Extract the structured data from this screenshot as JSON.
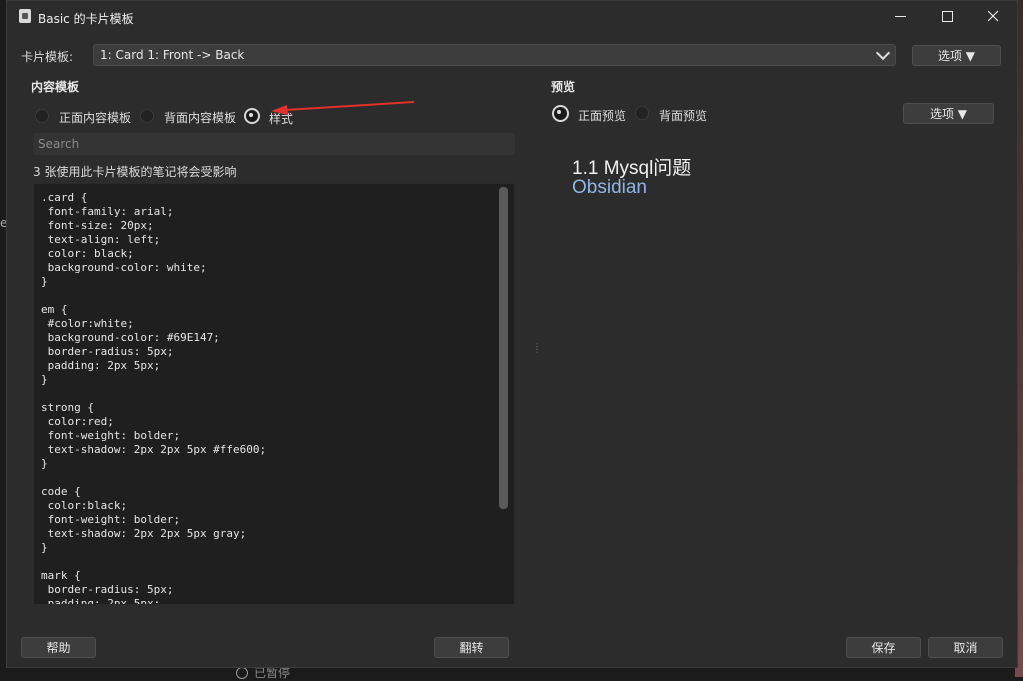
{
  "window": {
    "title": "Basic 的卡片模板"
  },
  "header": {
    "template_label": "卡片模板:",
    "template_value": "1: Card 1: Front -> Back",
    "options_button": "选项 ▼"
  },
  "content": {
    "section_title": "内容模板",
    "radios": [
      {
        "label": "正面内容模板",
        "checked": false
      },
      {
        "label": "背面内容模板",
        "checked": false
      },
      {
        "label": "样式",
        "checked": true
      }
    ],
    "search_placeholder": "Search",
    "affects_text": "3 张使用此卡片模板的笔记将会受影响",
    "editor_text": ".card {\n font-family: arial;\n font-size: 20px;\n text-align: left;\n color: black;\n background-color: white;\n}\n\nem {\n #color:white;\n background-color: #69E147;\n border-radius: 5px;\n padding: 2px 5px;\n}\n\nstrong {\n color:red;\n font-weight: bolder;\n text-shadow: 2px 2px 5px #ffe600;\n}\n\ncode {\n color:black;\n font-weight: bolder;\n text-shadow: 2px 2px 5px gray;\n}\n\nmark {\n border-radius: 5px;\n padding: 2px 5px;"
  },
  "preview": {
    "section_title": "预览",
    "radios": [
      {
        "label": "正面预览",
        "checked": true
      },
      {
        "label": "背面预览",
        "checked": false
      }
    ],
    "options_button": "选项 ▼",
    "question": "1.1 Mysql问题",
    "answer": "Obsidian"
  },
  "footer": {
    "help": "帮助",
    "flip": "翻转",
    "save": "保存",
    "cancel": "取消"
  },
  "background": {
    "bottom_text": "已暂停",
    "left_char": "e"
  },
  "colors": {
    "window_bg": "#2c2c2c",
    "editor_bg": "#1f1f1f",
    "answer_text": "#8fb4e8",
    "annotation_arrow": "#e0312a"
  }
}
